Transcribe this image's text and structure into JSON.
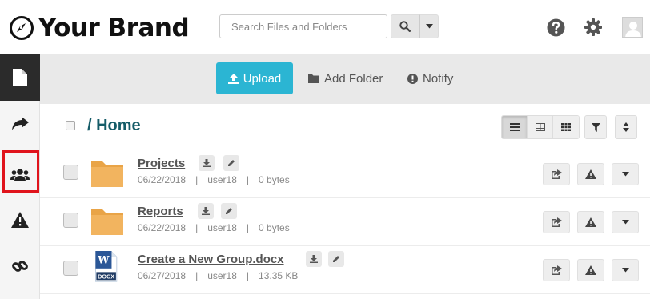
{
  "header": {
    "brand_name": "Your Brand",
    "search_placeholder": "Search Files and Folders",
    "icons": [
      "search-icon",
      "caret-down-icon",
      "help-icon",
      "gear-icon",
      "avatar"
    ]
  },
  "sidebar": {
    "items": [
      {
        "icon": "file-icon",
        "active": true
      },
      {
        "icon": "share-icon",
        "active": false
      },
      {
        "icon": "users-icon",
        "active": false,
        "highlighted": true
      },
      {
        "icon": "warning-icon",
        "active": false
      },
      {
        "icon": "link-icon",
        "active": false
      }
    ]
  },
  "toolbar": {
    "upload_label": "Upload",
    "add_folder_label": "Add Folder",
    "notify_label": "Notify"
  },
  "main": {
    "breadcrumb": "/ Home",
    "view_modes": [
      "list",
      "grid-small",
      "grid-large"
    ],
    "active_view": "list",
    "rows": [
      {
        "name": "Projects",
        "type": "folder",
        "date": "06/22/2018",
        "owner": "user18",
        "size": "0 bytes"
      },
      {
        "name": "Reports",
        "type": "folder",
        "date": "06/22/2018",
        "owner": "user18",
        "size": "0 bytes"
      },
      {
        "name": "Create a New Group.docx",
        "type": "docx",
        "date": "06/27/2018",
        "owner": "user18",
        "size": "13.35 KB"
      }
    ],
    "meta_separator": "|",
    "docx_badge": "DOCX"
  },
  "colors": {
    "accent": "#2bb5d3",
    "breadcrumb": "#155c68",
    "folder": "#f2b45f",
    "highlight": "#e0141c",
    "sidebar_active": "#2b2b2b"
  }
}
